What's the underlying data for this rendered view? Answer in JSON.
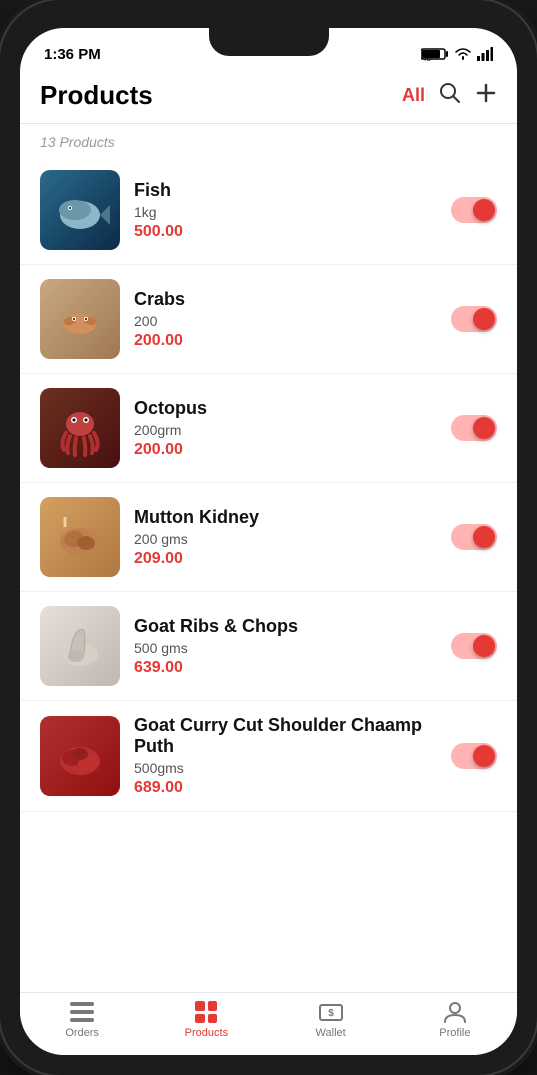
{
  "statusBar": {
    "time": "1:36 PM",
    "icons": "signal wifi battery"
  },
  "header": {
    "title": "Products",
    "filterLabel": "All",
    "searchIcon": "search",
    "addIcon": "plus"
  },
  "productsCount": "13 Products",
  "products": [
    {
      "id": 1,
      "name": "Fish",
      "qty": "1kg",
      "price": "500.00",
      "imgClass": "img-fish",
      "emoji": "🐟",
      "toggleState": "on"
    },
    {
      "id": 2,
      "name": "Crabs",
      "qty": "200",
      "price": "200.00",
      "imgClass": "img-crabs",
      "emoji": "🦀",
      "toggleState": "on"
    },
    {
      "id": 3,
      "name": "Octopus",
      "qty": "200grm",
      "price": "200.00",
      "imgClass": "img-octopus",
      "emoji": "🐙",
      "toggleState": "on"
    },
    {
      "id": 4,
      "name": "Mutton Kidney",
      "qty": "200 gms",
      "price": "209.00",
      "imgClass": "img-mutton",
      "emoji": "🥩",
      "toggleState": "on"
    },
    {
      "id": 5,
      "name": "Goat Ribs & Chops",
      "qty": "500 gms",
      "price": "639.00",
      "imgClass": "img-goatribs",
      "emoji": "🍖",
      "toggleState": "on"
    },
    {
      "id": 6,
      "name": "Goat Curry Cut Shoulder Chaamp Puth",
      "qty": "500gms",
      "price": "689.00",
      "imgClass": "img-goatcurry",
      "emoji": "🥩",
      "toggleState": "on"
    }
  ],
  "bottomNav": {
    "items": [
      {
        "id": "orders",
        "label": "Orders",
        "active": false
      },
      {
        "id": "products",
        "label": "Products",
        "active": true
      },
      {
        "id": "wallet",
        "label": "Wallet",
        "active": false
      },
      {
        "id": "profile",
        "label": "Profile",
        "active": false
      }
    ]
  }
}
